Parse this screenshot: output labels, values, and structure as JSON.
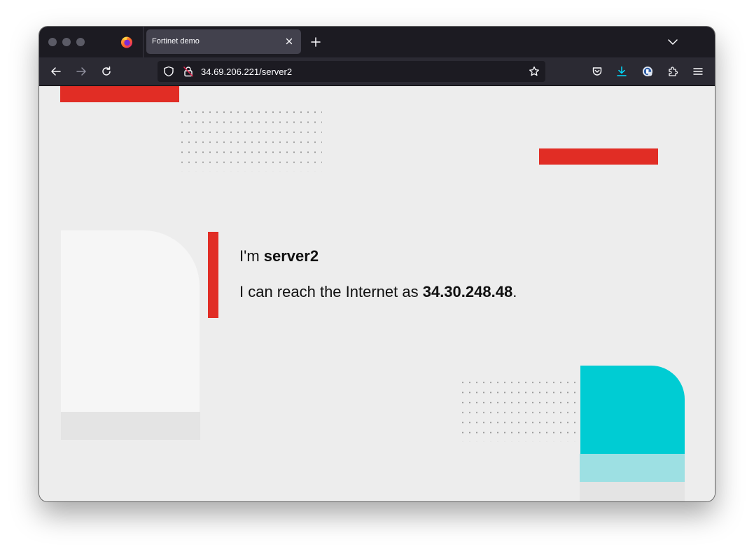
{
  "browser": {
    "tab": {
      "title": "Fortinet demo"
    },
    "url": "34.69.206.221/server2"
  },
  "page": {
    "line1_prefix": "I'm ",
    "server_name": "server2",
    "line2_prefix": "I can reach the Internet as ",
    "public_ip": "34.30.248.48",
    "line2_suffix": "."
  },
  "colors": {
    "brand_red": "#e12d25",
    "teal": "#00ccd3",
    "teal_light": "#9de0e3",
    "download_blue": "#0df"
  },
  "icons": [
    "firefox-logo-icon",
    "close-icon",
    "plus-icon",
    "chevron-down-icon",
    "back-arrow-icon",
    "forward-arrow-icon",
    "reload-icon",
    "shield-icon",
    "insecure-lock-icon",
    "star-icon",
    "pocket-icon",
    "download-icon",
    "extension-avatar-icon",
    "puzzle-icon",
    "hamburger-menu-icon"
  ]
}
